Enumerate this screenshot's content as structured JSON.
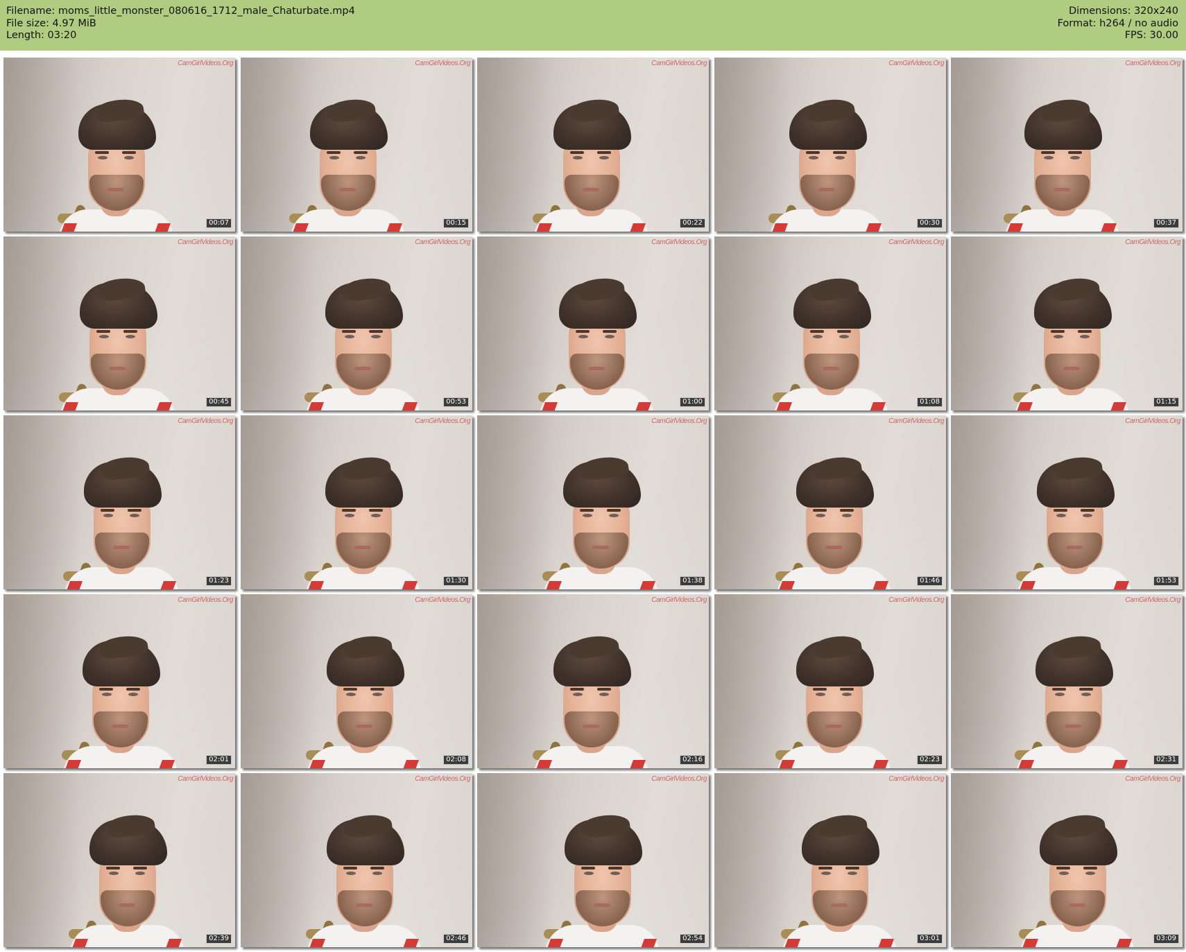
{
  "header": {
    "filename_label": "Filename:",
    "filename": "moms_little_monster_080616_1712_male_Chaturbate.mp4",
    "filesize_label": "File size:",
    "filesize": "4.97 MiB",
    "length_label": "Length:",
    "length": "03:20",
    "dimensions_label": "Dimensions:",
    "dimensions": "320x240",
    "format_label": "Format:",
    "format": "h264 / no audio",
    "fps_label": "FPS:",
    "fps": "30.00",
    "background_color": "#b0cc80"
  },
  "watermark": "CamGirlVideos.Org",
  "thumbnails": [
    {
      "time": "00:07"
    },
    {
      "time": "00:15"
    },
    {
      "time": "00:22"
    },
    {
      "time": "00:30"
    },
    {
      "time": "00:37"
    },
    {
      "time": "00:45"
    },
    {
      "time": "00:53"
    },
    {
      "time": "01:00"
    },
    {
      "time": "01:08"
    },
    {
      "time": "01:15"
    },
    {
      "time": "01:23"
    },
    {
      "time": "01:30"
    },
    {
      "time": "01:38"
    },
    {
      "time": "01:46"
    },
    {
      "time": "01:53"
    },
    {
      "time": "02:01"
    },
    {
      "time": "02:08"
    },
    {
      "time": "02:16"
    },
    {
      "time": "02:23"
    },
    {
      "time": "02:31"
    },
    {
      "time": "02:39"
    },
    {
      "time": "02:46"
    },
    {
      "time": "02:54"
    },
    {
      "time": "03:01"
    },
    {
      "time": "03:09"
    }
  ]
}
